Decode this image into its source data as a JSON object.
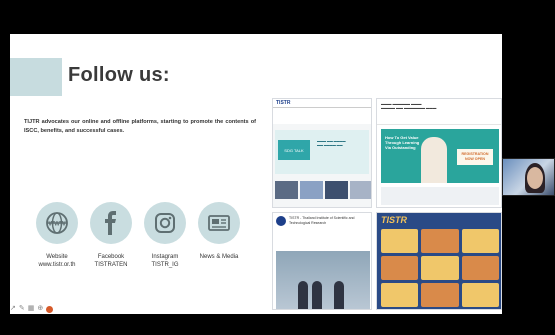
{
  "slide": {
    "title": "Follow us:",
    "body": "TIJTR advocates our online and offline platforms, starting to promote the contents of ISCC, benefits, and successful cases.",
    "social": [
      {
        "icon": "globe-icon",
        "name": "Website",
        "handle": "www.tistr.or.th"
      },
      {
        "icon": "facebook-icon",
        "name": "Facebook",
        "handle": "TISTRATEN"
      },
      {
        "icon": "instagram-icon",
        "name": "Instagram",
        "handle": "TISTR_IG"
      },
      {
        "icon": "news-icon",
        "name": "News & Media",
        "handle": ""
      }
    ],
    "collage": {
      "panel1": {
        "logo": "TISTR",
        "button": "SDG TALK"
      },
      "panel2": {
        "banner_title": "How To Get Value Through Learning Via Outstanding",
        "banner_tag": "REGISTRATION NOW OPEN"
      },
      "panel3": {
        "caption": "TISTR - Thailand Institute of Scientific and Technological Research"
      },
      "panel4": {
        "heading": "TISTR"
      }
    }
  },
  "colors": {
    "accent_teal": "#c7dcdf",
    "banner_teal": "#2aa59c",
    "poster_blue": "#2a4a86"
  },
  "toolbar_icons": [
    "arrow-icon",
    "pen-icon",
    "grid-icon",
    "zoom-icon",
    "more-icon"
  ]
}
